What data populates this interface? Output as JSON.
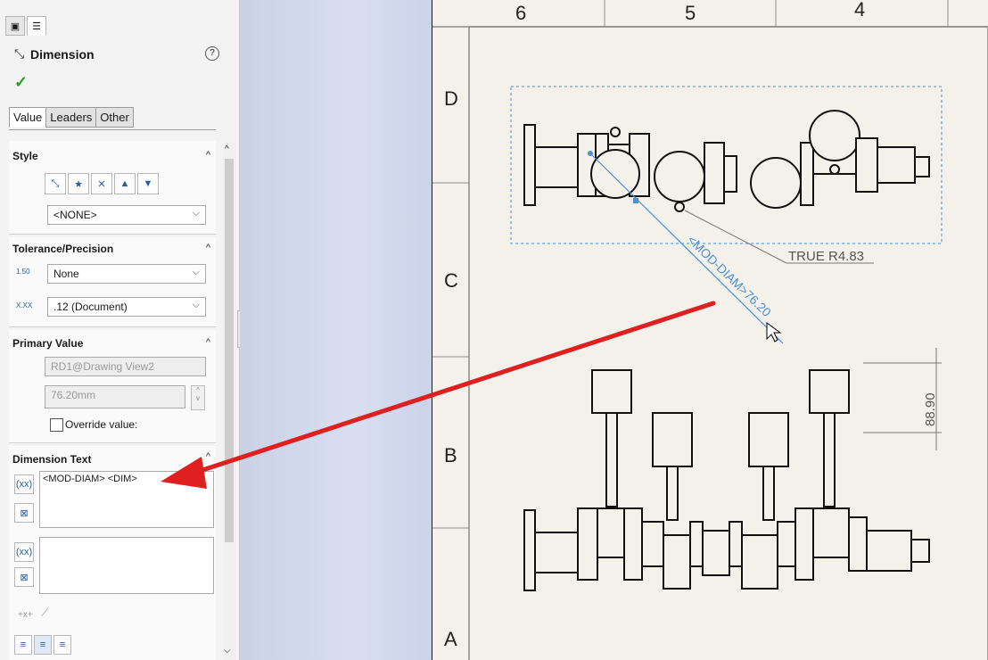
{
  "property_manager": {
    "title": "Dimension",
    "help": "?",
    "tabs": [
      "Value",
      "Leaders",
      "Other"
    ],
    "style": {
      "header": "Style",
      "dropdown": "<NONE>"
    },
    "tolerance": {
      "header": "Tolerance/Precision",
      "tolerance_type": "None",
      "precision": ".12 (Document)"
    },
    "primary_value": {
      "header": "Primary Value",
      "name": "RD1@Drawing View2",
      "value": "76.20mm",
      "override_label": "Override value:"
    },
    "dimension_text": {
      "header": "Dimension Text",
      "text": "<MOD-DIAM> <DIM>"
    }
  },
  "drawing": {
    "column_labels": [
      "6",
      "5",
      "4"
    ],
    "row_labels": [
      "D",
      "C",
      "B",
      "A"
    ],
    "annotation_radius": "TRUE R4.83",
    "annotation_dim": "<MOD-DIAM>76.20",
    "annotation_height": "88.90"
  },
  "colors": {
    "arrow": "#e02020",
    "dimension_blue": "#4a90d9",
    "sheet": "#f3f1ea"
  }
}
